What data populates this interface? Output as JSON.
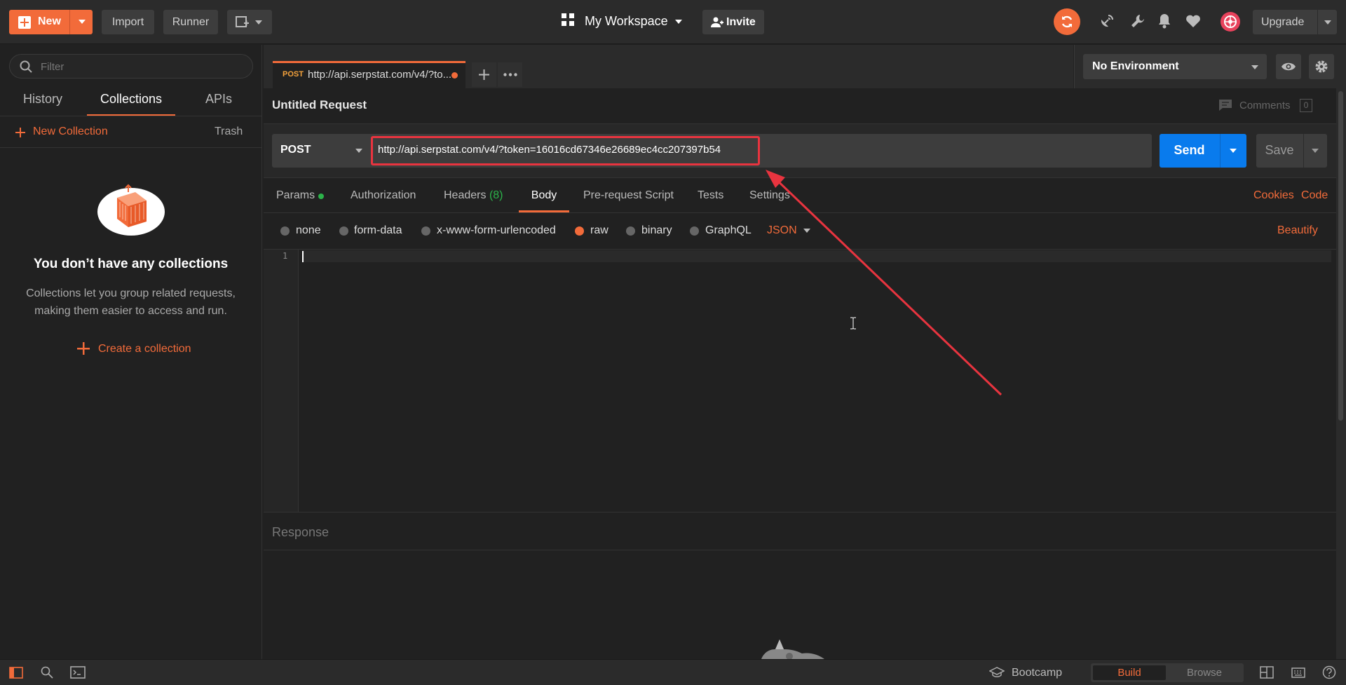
{
  "topbar": {
    "new_label": "New",
    "import_label": "Import",
    "runner_label": "Runner",
    "workspace_label": "My Workspace",
    "invite_label": "Invite",
    "upgrade_label": "Upgrade"
  },
  "sidebar": {
    "filter_placeholder": "Filter",
    "tabs": [
      {
        "label": "History"
      },
      {
        "label": "Collections"
      },
      {
        "label": "APIs"
      }
    ],
    "new_collection_label": "New Collection",
    "trash_label": "Trash",
    "empty_title": "You don’t have any collections",
    "empty_desc_line1": "Collections let you group related requests,",
    "empty_desc_line2": "making them easier to access and run.",
    "create_label": "Create a collection"
  },
  "request_tab": {
    "method": "POST",
    "title": "http://api.serpstat.com/v4/?to..."
  },
  "environment": {
    "selected": "No Environment"
  },
  "request": {
    "name": "Untitled Request",
    "comments_label": "Comments",
    "comments_count": "0",
    "method": "POST",
    "url": "http://api.serpstat.com/v4/?token=16016cd67346e26689ec4cc207397b54",
    "send_label": "Send",
    "save_label": "Save"
  },
  "request_tabs": {
    "params": "Params",
    "authorization": "Authorization",
    "headers": "Headers",
    "headers_count": "(8)",
    "body": "Body",
    "prerequest": "Pre-request Script",
    "tests": "Tests",
    "settings": "Settings",
    "cookies": "Cookies",
    "code": "Code"
  },
  "body_options": {
    "none": "none",
    "form_data": "form-data",
    "urlencoded": "x-www-form-urlencoded",
    "raw": "raw",
    "binary": "binary",
    "graphql": "GraphQL",
    "format": "JSON",
    "beautify": "Beautify"
  },
  "editor": {
    "line_number": "1"
  },
  "response": {
    "label": "Response"
  },
  "statusbar": {
    "bootcamp_label": "Bootcamp",
    "build_label": "Build",
    "browse_label": "Browse"
  },
  "colors": {
    "accent": "#f26b3a",
    "send_blue": "#097bed",
    "annotation_red": "#e8343f"
  }
}
